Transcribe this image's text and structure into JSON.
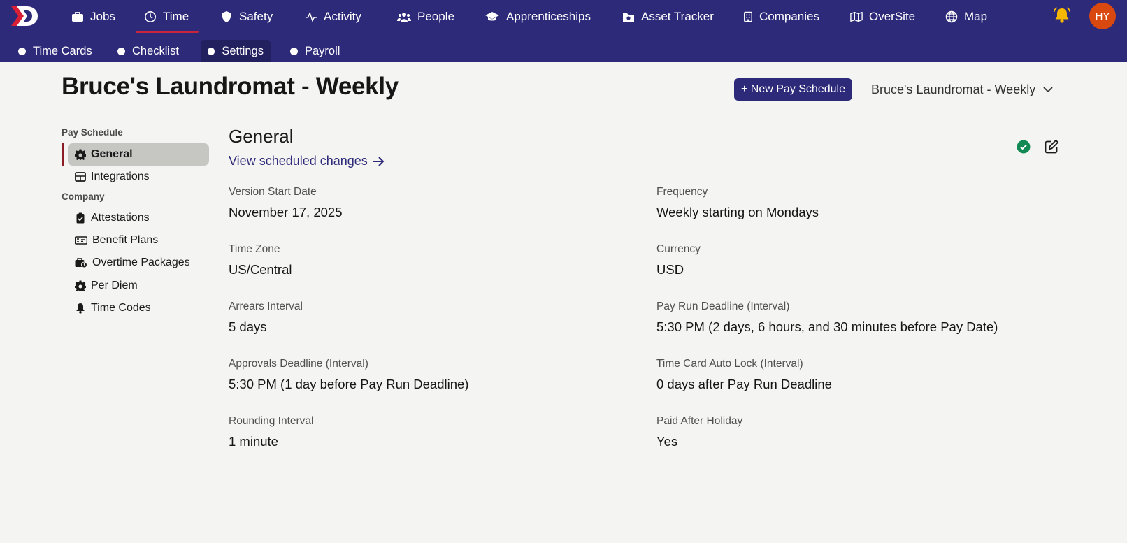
{
  "nav": {
    "items": [
      {
        "label": "Jobs",
        "icon": "briefcase-icon"
      },
      {
        "label": "Time",
        "icon": "clock-icon"
      },
      {
        "label": "Safety",
        "icon": "shield-icon"
      },
      {
        "label": "Activity",
        "icon": "pulse-icon"
      },
      {
        "label": "People",
        "icon": "people-icon"
      },
      {
        "label": "Apprenticeships",
        "icon": "graduation-cap-icon"
      },
      {
        "label": "Asset Tracker",
        "icon": "camera-box-icon"
      },
      {
        "label": "Companies",
        "icon": "building-icon"
      },
      {
        "label": "OverSite",
        "icon": "map-fold-icon"
      },
      {
        "label": "Map",
        "icon": "globe-icon"
      }
    ],
    "active": "Time",
    "avatar_initials": "HY"
  },
  "subnav": {
    "items": [
      "Time Cards",
      "Checklist",
      "Settings",
      "Payroll"
    ],
    "active": "Settings"
  },
  "header": {
    "title": "Bruce's Laundromat - Weekly",
    "new_button": "+ New Pay Schedule",
    "schedule_select": "Bruce's Laundromat - Weekly"
  },
  "sidebar": {
    "pay_schedule_heading": "Pay Schedule",
    "pay_schedule_items": [
      {
        "label": "General",
        "icon": "gear-icon"
      },
      {
        "label": "Integrations",
        "icon": "table-icon"
      }
    ],
    "company_heading": "Company",
    "company_items": [
      {
        "label": "Attestations",
        "icon": "clipboard-check-icon"
      },
      {
        "label": "Benefit Plans",
        "icon": "money-check-icon"
      },
      {
        "label": "Overtime Packages",
        "icon": "briefcase-clock-icon"
      },
      {
        "label": "Per Diem",
        "icon": "gear-icon"
      },
      {
        "label": "Time Codes",
        "icon": "bell-icon"
      }
    ],
    "active": "General"
  },
  "main": {
    "title": "General",
    "changes_link": "View scheduled changes",
    "fields": [
      {
        "label": "Version Start Date",
        "value": "November 17, 2025"
      },
      {
        "label": "Frequency",
        "value": "Weekly starting on Mondays"
      },
      {
        "label": "Time Zone",
        "value": "US/Central"
      },
      {
        "label": "Currency",
        "value": "USD"
      },
      {
        "label": "Arrears Interval",
        "value": "5 days"
      },
      {
        "label": "Pay Run Deadline (Interval)",
        "value": "5:30 PM (2 days, 6 hours, and 30 minutes before Pay Date)"
      },
      {
        "label": "Approvals Deadline (Interval)",
        "value": "5:30 PM (1 day before Pay Run Deadline)"
      },
      {
        "label": "Time Card Auto Lock (Interval)",
        "value": "0 days after Pay Run Deadline"
      },
      {
        "label": "Rounding Interval",
        "value": "1 minute"
      },
      {
        "label": "Paid After Holiday",
        "value": "Yes"
      }
    ]
  },
  "colors": {
    "nav_bg": "#2e2a7a",
    "active_underline": "#c8253c",
    "active_side_bar": "#8c1d26",
    "status_green": "#138a54",
    "bell_yellow": "#f5b700",
    "avatar_orange": "#d9480f"
  }
}
